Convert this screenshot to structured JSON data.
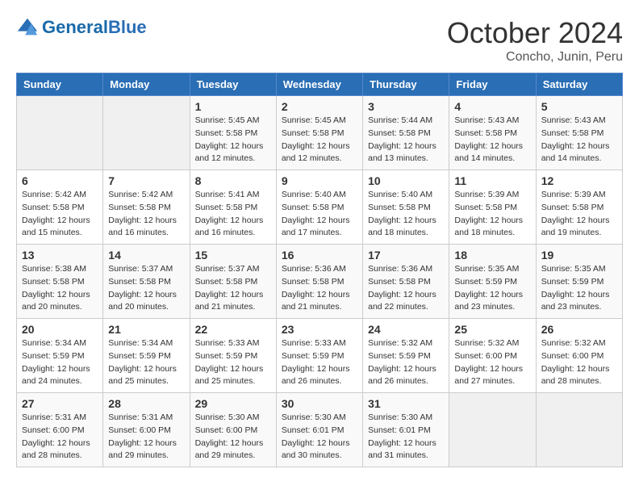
{
  "header": {
    "logo_general": "General",
    "logo_blue": "Blue",
    "month": "October 2024",
    "location": "Concho, Junin, Peru"
  },
  "days_of_week": [
    "Sunday",
    "Monday",
    "Tuesday",
    "Wednesday",
    "Thursday",
    "Friday",
    "Saturday"
  ],
  "weeks": [
    [
      {
        "day": "",
        "sunrise": "",
        "sunset": "",
        "daylight": ""
      },
      {
        "day": "",
        "sunrise": "",
        "sunset": "",
        "daylight": ""
      },
      {
        "day": "1",
        "sunrise": "Sunrise: 5:45 AM",
        "sunset": "Sunset: 5:58 PM",
        "daylight": "Daylight: 12 hours and 12 minutes."
      },
      {
        "day": "2",
        "sunrise": "Sunrise: 5:45 AM",
        "sunset": "Sunset: 5:58 PM",
        "daylight": "Daylight: 12 hours and 12 minutes."
      },
      {
        "day": "3",
        "sunrise": "Sunrise: 5:44 AM",
        "sunset": "Sunset: 5:58 PM",
        "daylight": "Daylight: 12 hours and 13 minutes."
      },
      {
        "day": "4",
        "sunrise": "Sunrise: 5:43 AM",
        "sunset": "Sunset: 5:58 PM",
        "daylight": "Daylight: 12 hours and 14 minutes."
      },
      {
        "day": "5",
        "sunrise": "Sunrise: 5:43 AM",
        "sunset": "Sunset: 5:58 PM",
        "daylight": "Daylight: 12 hours and 14 minutes."
      }
    ],
    [
      {
        "day": "6",
        "sunrise": "Sunrise: 5:42 AM",
        "sunset": "Sunset: 5:58 PM",
        "daylight": "Daylight: 12 hours and 15 minutes."
      },
      {
        "day": "7",
        "sunrise": "Sunrise: 5:42 AM",
        "sunset": "Sunset: 5:58 PM",
        "daylight": "Daylight: 12 hours and 16 minutes."
      },
      {
        "day": "8",
        "sunrise": "Sunrise: 5:41 AM",
        "sunset": "Sunset: 5:58 PM",
        "daylight": "Daylight: 12 hours and 16 minutes."
      },
      {
        "day": "9",
        "sunrise": "Sunrise: 5:40 AM",
        "sunset": "Sunset: 5:58 PM",
        "daylight": "Daylight: 12 hours and 17 minutes."
      },
      {
        "day": "10",
        "sunrise": "Sunrise: 5:40 AM",
        "sunset": "Sunset: 5:58 PM",
        "daylight": "Daylight: 12 hours and 18 minutes."
      },
      {
        "day": "11",
        "sunrise": "Sunrise: 5:39 AM",
        "sunset": "Sunset: 5:58 PM",
        "daylight": "Daylight: 12 hours and 18 minutes."
      },
      {
        "day": "12",
        "sunrise": "Sunrise: 5:39 AM",
        "sunset": "Sunset: 5:58 PM",
        "daylight": "Daylight: 12 hours and 19 minutes."
      }
    ],
    [
      {
        "day": "13",
        "sunrise": "Sunrise: 5:38 AM",
        "sunset": "Sunset: 5:58 PM",
        "daylight": "Daylight: 12 hours and 20 minutes."
      },
      {
        "day": "14",
        "sunrise": "Sunrise: 5:37 AM",
        "sunset": "Sunset: 5:58 PM",
        "daylight": "Daylight: 12 hours and 20 minutes."
      },
      {
        "day": "15",
        "sunrise": "Sunrise: 5:37 AM",
        "sunset": "Sunset: 5:58 PM",
        "daylight": "Daylight: 12 hours and 21 minutes."
      },
      {
        "day": "16",
        "sunrise": "Sunrise: 5:36 AM",
        "sunset": "Sunset: 5:58 PM",
        "daylight": "Daylight: 12 hours and 21 minutes."
      },
      {
        "day": "17",
        "sunrise": "Sunrise: 5:36 AM",
        "sunset": "Sunset: 5:58 PM",
        "daylight": "Daylight: 12 hours and 22 minutes."
      },
      {
        "day": "18",
        "sunrise": "Sunrise: 5:35 AM",
        "sunset": "Sunset: 5:59 PM",
        "daylight": "Daylight: 12 hours and 23 minutes."
      },
      {
        "day": "19",
        "sunrise": "Sunrise: 5:35 AM",
        "sunset": "Sunset: 5:59 PM",
        "daylight": "Daylight: 12 hours and 23 minutes."
      }
    ],
    [
      {
        "day": "20",
        "sunrise": "Sunrise: 5:34 AM",
        "sunset": "Sunset: 5:59 PM",
        "daylight": "Daylight: 12 hours and 24 minutes."
      },
      {
        "day": "21",
        "sunrise": "Sunrise: 5:34 AM",
        "sunset": "Sunset: 5:59 PM",
        "daylight": "Daylight: 12 hours and 25 minutes."
      },
      {
        "day": "22",
        "sunrise": "Sunrise: 5:33 AM",
        "sunset": "Sunset: 5:59 PM",
        "daylight": "Daylight: 12 hours and 25 minutes."
      },
      {
        "day": "23",
        "sunrise": "Sunrise: 5:33 AM",
        "sunset": "Sunset: 5:59 PM",
        "daylight": "Daylight: 12 hours and 26 minutes."
      },
      {
        "day": "24",
        "sunrise": "Sunrise: 5:32 AM",
        "sunset": "Sunset: 5:59 PM",
        "daylight": "Daylight: 12 hours and 26 minutes."
      },
      {
        "day": "25",
        "sunrise": "Sunrise: 5:32 AM",
        "sunset": "Sunset: 6:00 PM",
        "daylight": "Daylight: 12 hours and 27 minutes."
      },
      {
        "day": "26",
        "sunrise": "Sunrise: 5:32 AM",
        "sunset": "Sunset: 6:00 PM",
        "daylight": "Daylight: 12 hours and 28 minutes."
      }
    ],
    [
      {
        "day": "27",
        "sunrise": "Sunrise: 5:31 AM",
        "sunset": "Sunset: 6:00 PM",
        "daylight": "Daylight: 12 hours and 28 minutes."
      },
      {
        "day": "28",
        "sunrise": "Sunrise: 5:31 AM",
        "sunset": "Sunset: 6:00 PM",
        "daylight": "Daylight: 12 hours and 29 minutes."
      },
      {
        "day": "29",
        "sunrise": "Sunrise: 5:30 AM",
        "sunset": "Sunset: 6:00 PM",
        "daylight": "Daylight: 12 hours and 29 minutes."
      },
      {
        "day": "30",
        "sunrise": "Sunrise: 5:30 AM",
        "sunset": "Sunset: 6:01 PM",
        "daylight": "Daylight: 12 hours and 30 minutes."
      },
      {
        "day": "31",
        "sunrise": "Sunrise: 5:30 AM",
        "sunset": "Sunset: 6:01 PM",
        "daylight": "Daylight: 12 hours and 31 minutes."
      },
      {
        "day": "",
        "sunrise": "",
        "sunset": "",
        "daylight": ""
      },
      {
        "day": "",
        "sunrise": "",
        "sunset": "",
        "daylight": ""
      }
    ]
  ]
}
